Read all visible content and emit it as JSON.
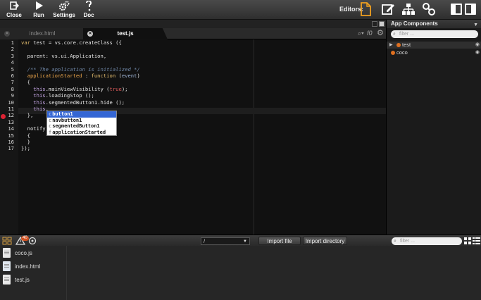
{
  "toolbar": {
    "buttons": [
      {
        "label": "Close",
        "icon": "close-icon"
      },
      {
        "label": "Run",
        "icon": "play-icon"
      },
      {
        "label": "Settings",
        "icon": "gears-icon"
      },
      {
        "label": "Doc",
        "icon": "doc-icon"
      }
    ],
    "editors_label": "Editors:",
    "editor_icons": [
      "file-icon",
      "pencil-icon",
      "hierarchy-icon",
      "link-icon"
    ],
    "accent_color": "#f0a020"
  },
  "tabs": [
    {
      "label": "index.html",
      "active": false
    },
    {
      "label": "test.js",
      "active": true
    }
  ],
  "tab_tools": {
    "search": "⌕▾",
    "func": "f0",
    "gear": "⚙"
  },
  "editor": {
    "lines": [
      {
        "n": "1"
      },
      {
        "n": "2"
      },
      {
        "n": "3"
      },
      {
        "n": "4"
      },
      {
        "n": "5"
      },
      {
        "n": "6"
      },
      {
        "n": "7"
      },
      {
        "n": "8"
      },
      {
        "n": "9"
      },
      {
        "n": "10"
      },
      {
        "n": "11"
      },
      {
        "n": "12"
      },
      {
        "n": "13"
      },
      {
        "n": "14"
      },
      {
        "n": "15"
      },
      {
        "n": "16"
      },
      {
        "n": "17"
      }
    ],
    "code": {
      "l1a": "var",
      "l1b": " test = vs.core.createClass ({",
      "l3": "  parent: vs.ui.Application,",
      "l5": "  /** The application is initialized */",
      "l6a": "  applicationStarted",
      "l6b": " : ",
      "l6c": "function",
      "l6d": " (",
      "l6e": "event",
      "l6f": ")",
      "l7": "  {",
      "l8a": "    this",
      "l8b": ".mainViewVisibility (",
      "l8c": "true",
      "l8d": ");",
      "l9a": "    this",
      "l9b": ".loadingStop ();",
      "l10a": "    this",
      "l10b": ".segmentedButton1.hide ();",
      "l11a": "    this",
      "l11b": ".",
      "l12": "  },",
      "l14": "  notify",
      "l15": "  {",
      "l16": "  }",
      "l17": "});"
    },
    "autocomplete": [
      {
        "prefix": "c",
        "text": "button1",
        "selected": true
      },
      {
        "prefix": "c",
        "text": "navbutton1",
        "selected": false
      },
      {
        "prefix": "c",
        "text": "segmentedButton1",
        "selected": false
      },
      {
        "prefix": "f",
        "text": "applicationStarted",
        "selected": false
      }
    ]
  },
  "right_panel": {
    "title": "App Components",
    "filter_placeholder": "filter ...",
    "components": [
      {
        "name": "test",
        "selected": true
      },
      {
        "name": "coco",
        "selected": false
      }
    ]
  },
  "bottom_bar": {
    "warning_count": "40",
    "path_value": "/",
    "import_file": "Import file",
    "import_directory": "Import directory",
    "filter_placeholder": "filter ..."
  },
  "files": [
    {
      "name": "coco.js",
      "icon": "js-file-icon"
    },
    {
      "name": "index.html",
      "icon": "html-file-icon"
    },
    {
      "name": "test.js",
      "icon": "js-file-icon"
    }
  ]
}
